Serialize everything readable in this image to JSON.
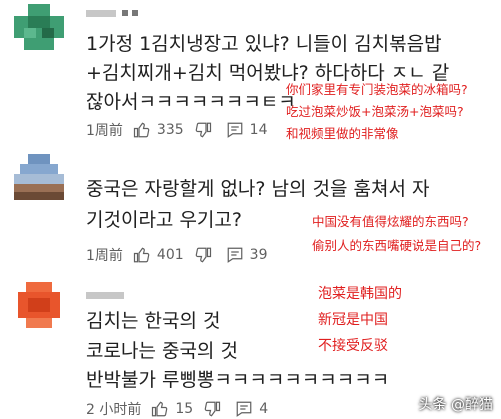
{
  "comments": [
    {
      "lines": [
        "1가정 1김치냉장고 있냐? 니들이 김치볶음밥",
        "+김치찌개+김치 먹어봤냐? 하다하다 ㅈㄴ 같",
        "잖아서ㅋㅋㅋㅋㅋㅋㅋㅌㅋ"
      ],
      "time": "1周前",
      "likes": "335",
      "replies": "14",
      "translation": [
        "你们家里有专门装泡菜的冰箱吗?",
        "吃过泡菜炒饭+泡菜汤+泡菜吗?",
        "和视频里做的非常像"
      ]
    },
    {
      "lines": [
        "중국은 자랑할게 없나? 남의 것을 훔쳐서 자",
        "기것이라고 우기고?"
      ],
      "time": "1周前",
      "likes": "401",
      "replies": "39",
      "translation": [
        "中国没有值得炫耀的东西吗?",
        "偷别人的东西嘴硬说是自己的?"
      ]
    },
    {
      "lines": [
        "김치는 한국의 것",
        "코로나는 중국의 것",
        "반박불가 루삥뽕ㅋㅋㅋㅋㅋㅋㅋㅋㅋㅋ"
      ],
      "time": "2 小时前",
      "likes": "15",
      "replies": "4",
      "translation": [
        "泡菜是韩国的",
        "新冠是中国",
        "不接受反驳"
      ]
    }
  ],
  "icons": {
    "like": "thumbs-up-icon",
    "dislike": "thumbs-down-icon",
    "reply": "reply-comment-icon"
  },
  "watermark": "头条 @醉猫",
  "colors": {
    "note_red": "#e02020",
    "meta_gray": "#606060",
    "avatar1": "#2f8f64",
    "avatar2": "#6f93bf",
    "avatar3": "#e8552c"
  }
}
